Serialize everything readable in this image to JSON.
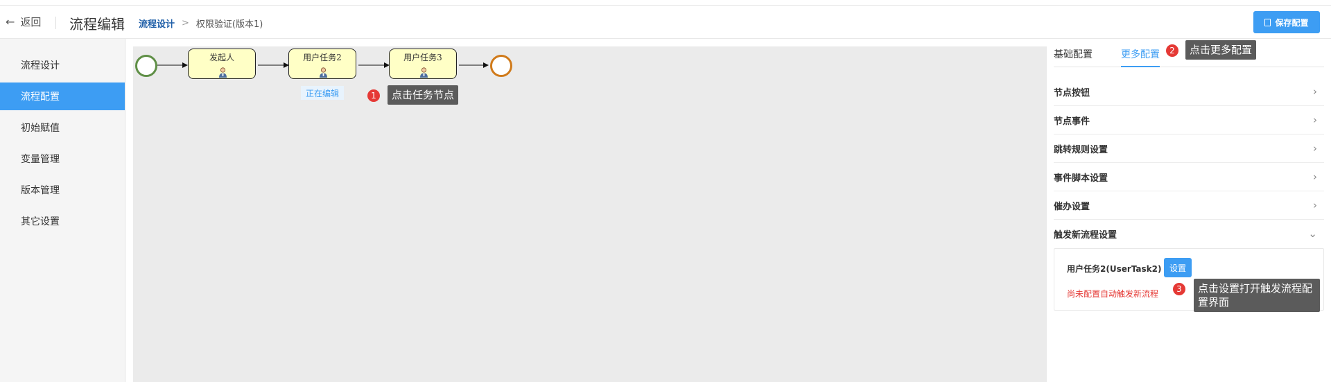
{
  "header": {
    "back_label": "返回",
    "app_title": "流程编辑",
    "breadcrumb": {
      "current_section": "流程设计",
      "separator": ">",
      "page": "权限验证(版本1)"
    },
    "save_label": "保存配置"
  },
  "sidebar": {
    "items": [
      {
        "label": "流程设计",
        "active": false
      },
      {
        "label": "流程配置",
        "active": true
      },
      {
        "label": "初始赋值",
        "active": false
      },
      {
        "label": "变量管理",
        "active": false
      },
      {
        "label": "版本管理",
        "active": false
      },
      {
        "label": "其它设置",
        "active": false
      }
    ]
  },
  "canvas": {
    "tasks": [
      {
        "name": "发起人",
        "icon": "person-icon"
      },
      {
        "name": "用户任务2",
        "icon": "person-icon"
      },
      {
        "name": "用户任务3",
        "icon": "person-icon"
      }
    ],
    "editing_tag": "正在编辑"
  },
  "panel": {
    "tabs": [
      {
        "label": "基础配置",
        "active": false
      },
      {
        "label": "更多配置",
        "active": true
      }
    ],
    "sections": [
      {
        "label": "节点按钮",
        "expanded": false
      },
      {
        "label": "节点事件",
        "expanded": false
      },
      {
        "label": "跳转规则设置",
        "expanded": false
      },
      {
        "label": "事件脚本设置",
        "expanded": false
      },
      {
        "label": "催办设置",
        "expanded": false
      },
      {
        "label": "触发新流程设置",
        "expanded": true
      }
    ],
    "trigger": {
      "task_label": "用户任务2(UserTask2)",
      "set_button": "设置",
      "warning": "尚未配置自动触发新流程"
    }
  },
  "callouts": [
    {
      "num": "1",
      "text": "点击任务节点"
    },
    {
      "num": "2",
      "text": "点击更多配置"
    },
    {
      "num": "3",
      "text_line1": "点击设置打开触发流程配",
      "text_line2": "置界面"
    }
  ],
  "colors": {
    "accent": "#3d9df3",
    "task_fill": "#ffffc6",
    "start_event": "#5f8f46",
    "end_event": "#d07a1a",
    "warning": "#e53935",
    "callout_bg": "#5b5b5b"
  }
}
